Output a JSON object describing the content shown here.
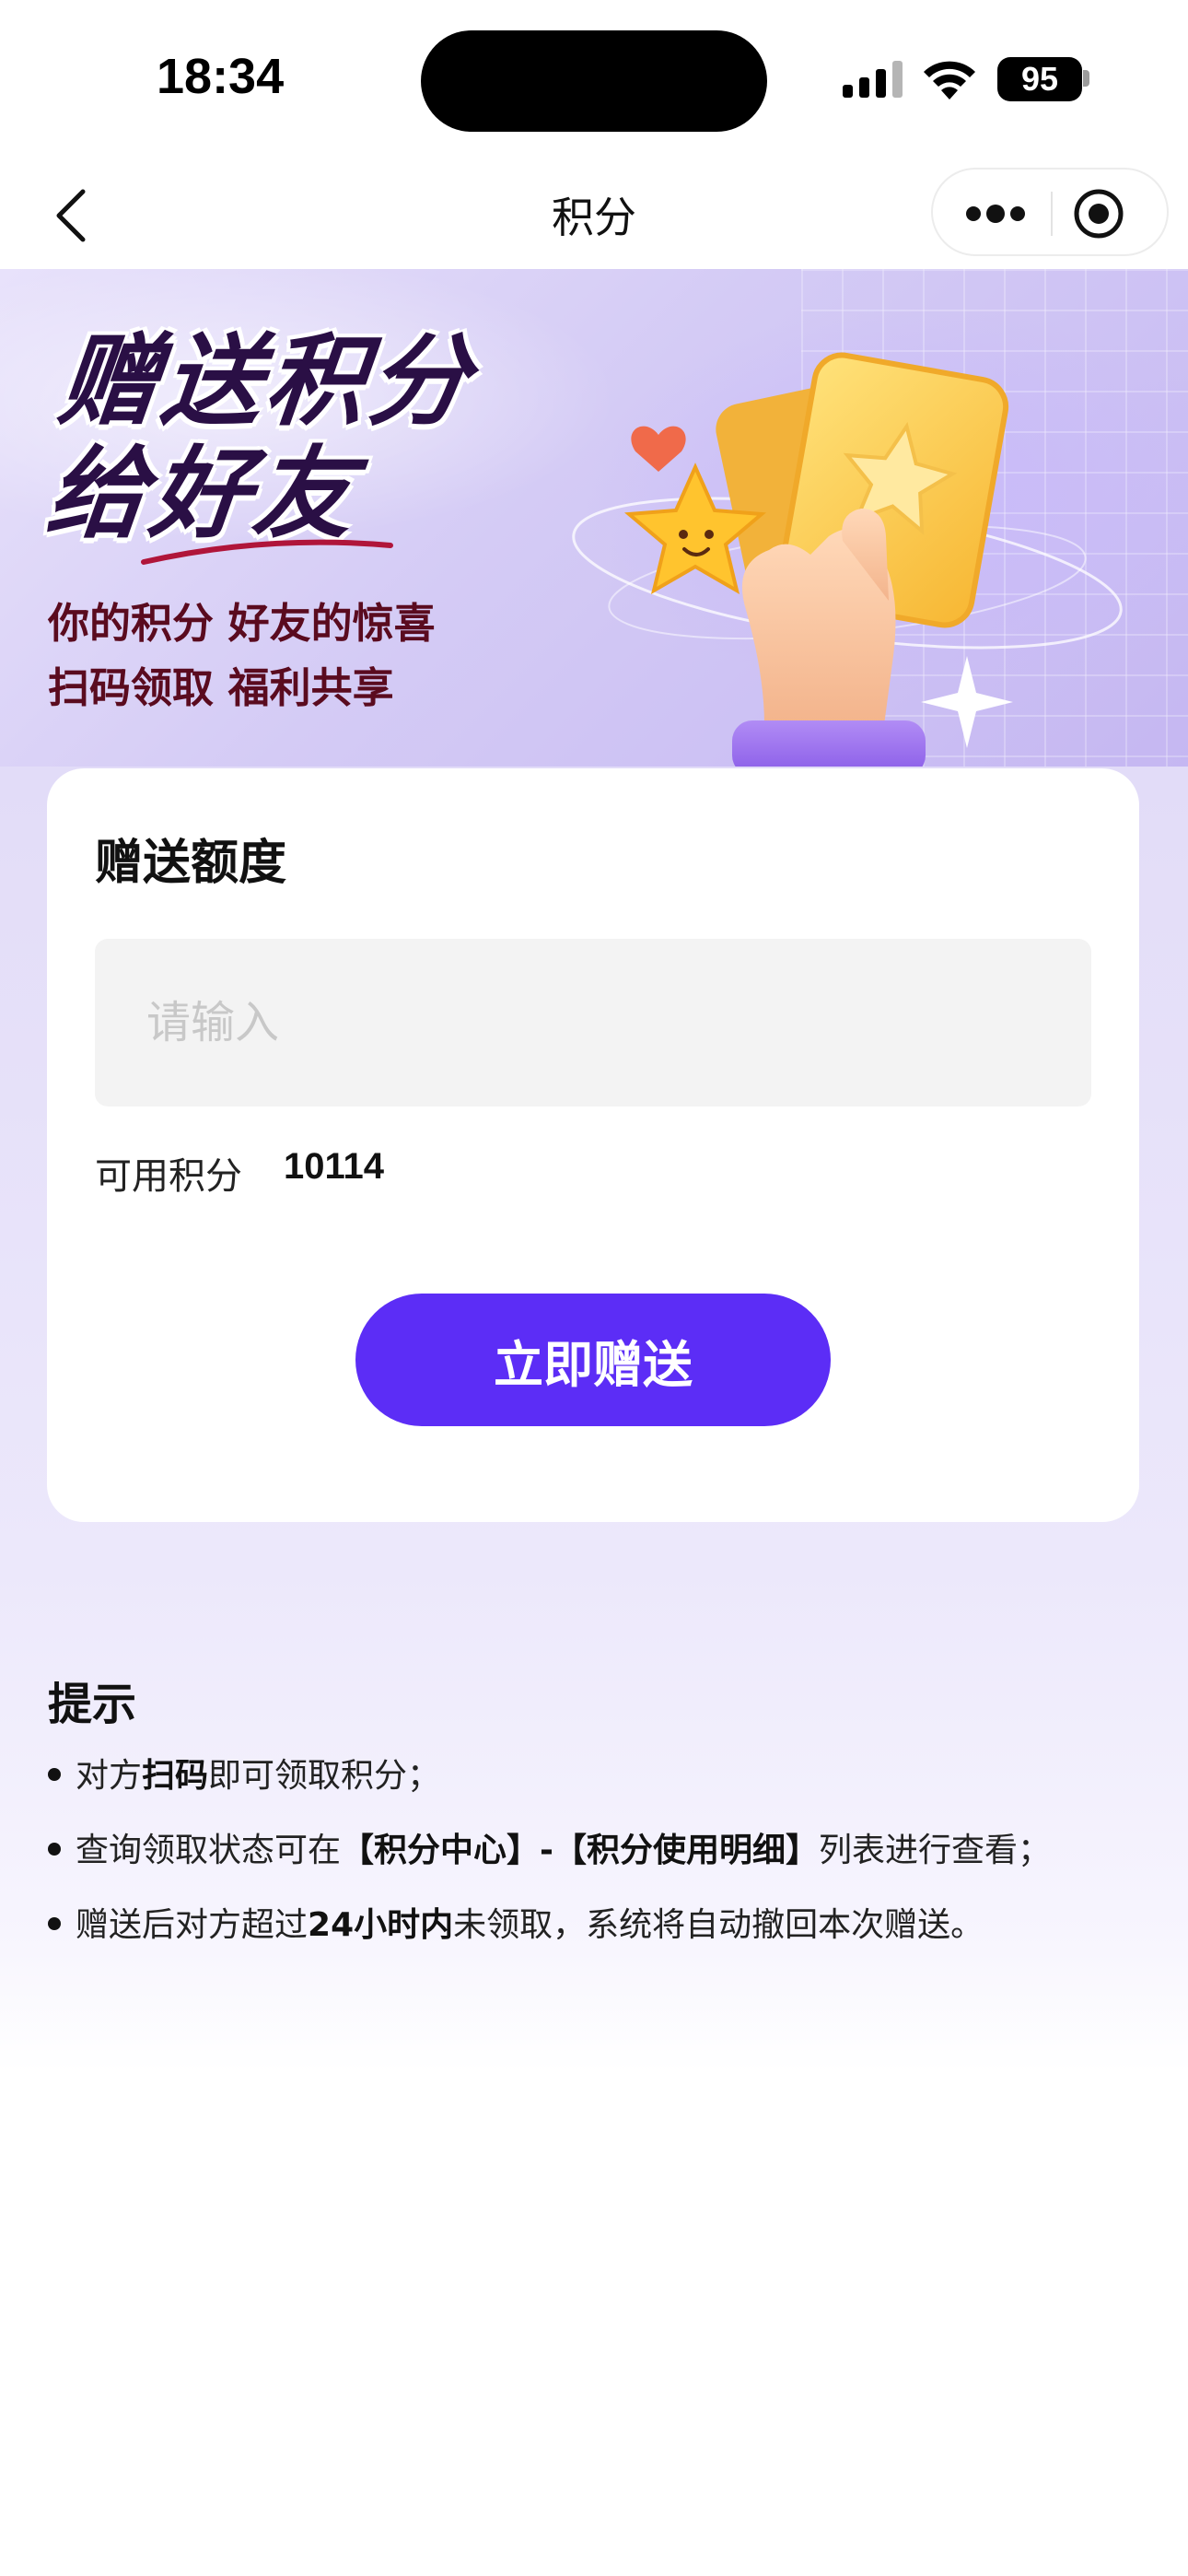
{
  "status_bar": {
    "time": "18:34",
    "battery": "95"
  },
  "nav": {
    "title": "积分"
  },
  "banner": {
    "headline_line1": "赠送积分",
    "headline_line2": "给好友",
    "slogan_line1": "你的积分 好友的惊喜",
    "slogan_line2": "扫码领取 福利共享"
  },
  "card": {
    "title": "赠送额度",
    "input_placeholder": "请输入",
    "input_value": "",
    "available_label": "可用积分",
    "available_value": "10114",
    "send_button": "立即赠送"
  },
  "tips": {
    "title": "提示",
    "items": [
      {
        "pre": "对方",
        "bold": "扫码",
        "post": "即可领取积分；"
      },
      {
        "pre": "查询领取状态可在",
        "bold": "【积分中心】-【积分使用明细】",
        "post": "列表进行查看；"
      },
      {
        "pre": "赠送后对方超过",
        "bold": "24小时内",
        "post": "未领取，系统将自动撤回本次赠送。"
      }
    ]
  },
  "colors": {
    "accent": "#5c2df6",
    "headline": "#2a0f45",
    "slogan": "#5a0b1f"
  }
}
